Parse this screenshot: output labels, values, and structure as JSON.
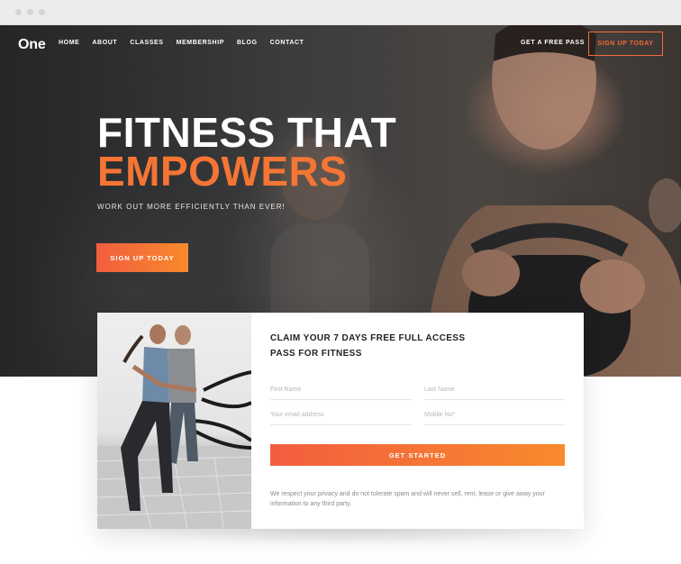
{
  "colors": {
    "accent": "#f47534",
    "accent_start": "#f25d3f",
    "accent_end": "#f88a2c"
  },
  "header": {
    "logo": "One",
    "nav": [
      "HOME",
      "ABOUT",
      "CLASSES",
      "MEMBERSHIP",
      "BLOG",
      "CONTACT"
    ],
    "free_pass": "GET A FREE PASS",
    "cta": "SIGN UP TODAY"
  },
  "hero": {
    "title_line1": "FITNESS THAT",
    "title_line2": "EMPOWERS",
    "subtitle": "WORK OUT MORE EFFICIENTLY THAN EVER!",
    "cta": "SIGN UP TODAY"
  },
  "form": {
    "title": "CLAIM YOUR 7 DAYS FREE FULL ACCESS PASS FOR FITNESS",
    "first_name": "First Name",
    "last_name": "Last Name",
    "email": "Your email address",
    "mobile": "Mobile No*",
    "submit": "GET STARTED",
    "privacy": "We respect your privacy and do not tolerate spam and will never sell, rent, lease or give away your information to any third party."
  }
}
